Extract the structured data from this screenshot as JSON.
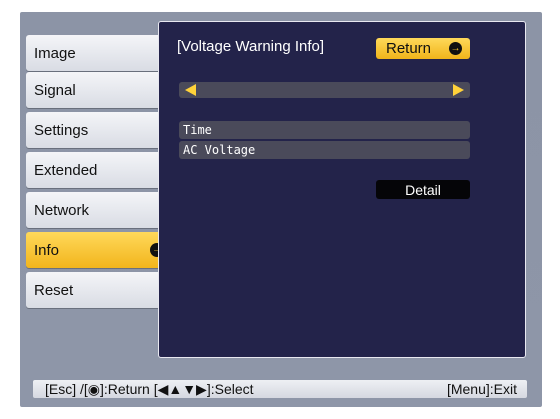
{
  "sidebar": {
    "items": [
      {
        "label": "Image"
      },
      {
        "label": "Signal"
      },
      {
        "label": "Settings"
      },
      {
        "label": "Extended"
      },
      {
        "label": "Network"
      },
      {
        "label": "Info"
      },
      {
        "label": "Reset"
      }
    ],
    "active_index": 5
  },
  "panel": {
    "title": "[Voltage Warning Info]",
    "return_label": "Return",
    "rows": [
      {
        "label": "Time"
      },
      {
        "label": "AC Voltage"
      }
    ],
    "detail_label": "Detail"
  },
  "statusbar": {
    "left": "[Esc] /[◉]:Return   [◀▲▼▶]:Select",
    "right": "[Menu]:Exit"
  },
  "colors": {
    "accent": "#f2b51c",
    "panel_bg": "#23234a",
    "frame_bg": "#8c94a6"
  },
  "icons": {
    "enter": "enter-circle-icon",
    "left": "arrow-left-icon",
    "right": "arrow-right-icon"
  }
}
